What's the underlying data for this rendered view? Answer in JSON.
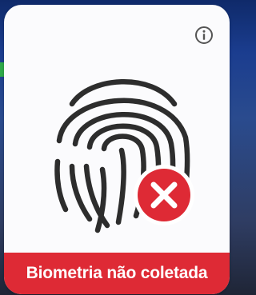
{
  "card": {
    "status_label": "Biometria não coletada",
    "status_color": "#de2a35",
    "icons": {
      "info": "info-icon",
      "fingerprint": "fingerprint-icon",
      "error": "close-circle-icon"
    }
  }
}
